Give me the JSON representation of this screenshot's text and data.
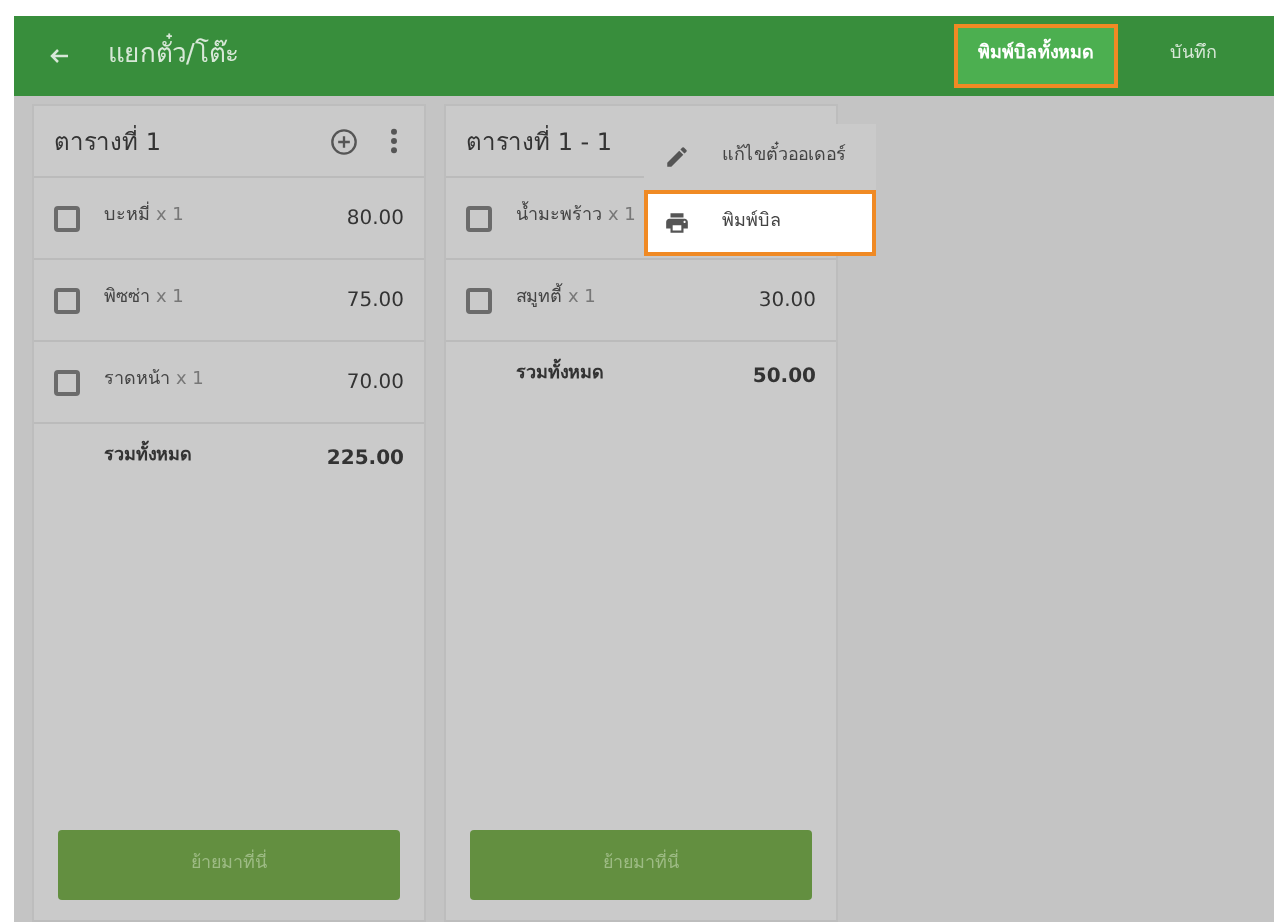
{
  "header": {
    "title": "แยกตั๋ว/โต๊ะ",
    "actions": [
      {
        "label": "พิมพ์บิลทั้งหมด",
        "kind": "filled",
        "highlighted": true
      },
      {
        "label": "บันทึก",
        "kind": "text",
        "highlighted": false
      }
    ]
  },
  "tables": [
    {
      "title": "ตารางที่ 1",
      "items": [
        {
          "name": "บะหมี่",
          "qty": "x 1",
          "price": "80.00",
          "checked": false
        },
        {
          "name": "พิซซ่า",
          "qty": "x 1",
          "price": "75.00",
          "checked": false
        },
        {
          "name": "ราดหน้า",
          "qty": "x 1",
          "price": "70.00",
          "checked": false
        }
      ],
      "total_label": "รวมทั้งหมด",
      "total": "225.00",
      "button": "ย้ายมาที่นี่"
    },
    {
      "title": "ตารางที่ 1 - 1",
      "items": [
        {
          "name": "น้ำมะพร้าว",
          "qty": "x 1",
          "checked": false
        },
        {
          "name": "สมูทตี้",
          "qty": "x 1",
          "price": "30.00",
          "checked": false
        }
      ],
      "total_label": "รวมทั้งหมด",
      "total": "50.00",
      "button": "ย้ายมาที่นี่"
    }
  ],
  "menu": {
    "items": [
      {
        "label": "แก้ไขตั๋วออเดอร์",
        "kind": "edit",
        "highlighted": false
      },
      {
        "label": "พิมพ์บิล",
        "kind": "print",
        "highlighted": true
      }
    ]
  }
}
